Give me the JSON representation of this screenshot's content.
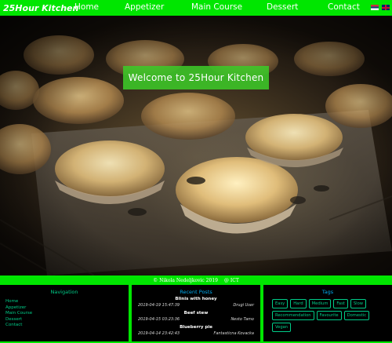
{
  "navbar": {
    "brand": "25Hour Kitchen",
    "links": [
      "Home",
      "Appetizer",
      "Main Course",
      "Dessert",
      "Contact"
    ]
  },
  "hero": {
    "welcome": "Welcome to 25Hour Kitchen"
  },
  "copyright": {
    "text": "© Nikola Nedeljkovic 2019",
    "org": "@ ICT"
  },
  "footer": {
    "navigation": {
      "title": "Navigation",
      "items": [
        "Home",
        "Appetizer",
        "Main Course",
        "Dessert",
        "Contact"
      ]
    },
    "recent_posts": {
      "title": "Recent Posts",
      "posts": [
        {
          "title": "Blinis with honey",
          "date": "2019-04-19 15:47:39",
          "author": "Drugi User"
        },
        {
          "title": "Beef stew",
          "date": "2019-04-15 03:23:36",
          "author": "Nesto Tamo"
        },
        {
          "title": "Blueberry pie",
          "date": "2019-04-14 23:42:43",
          "author": "Fantasticna Kovacka"
        }
      ]
    },
    "tags": {
      "title": "Tags",
      "items": [
        "Easy",
        "Hard",
        "Medium",
        "Fast",
        "Slow",
        "Recommendation",
        "Favourite",
        "Domestic",
        "Vegan"
      ]
    }
  },
  "colors": {
    "accent": "#00e600",
    "footer_text": "#00cc88",
    "title_blue": "#00aaee"
  },
  "icons": [
    "serbian-flag-icon",
    "uk-flag-icon"
  ]
}
